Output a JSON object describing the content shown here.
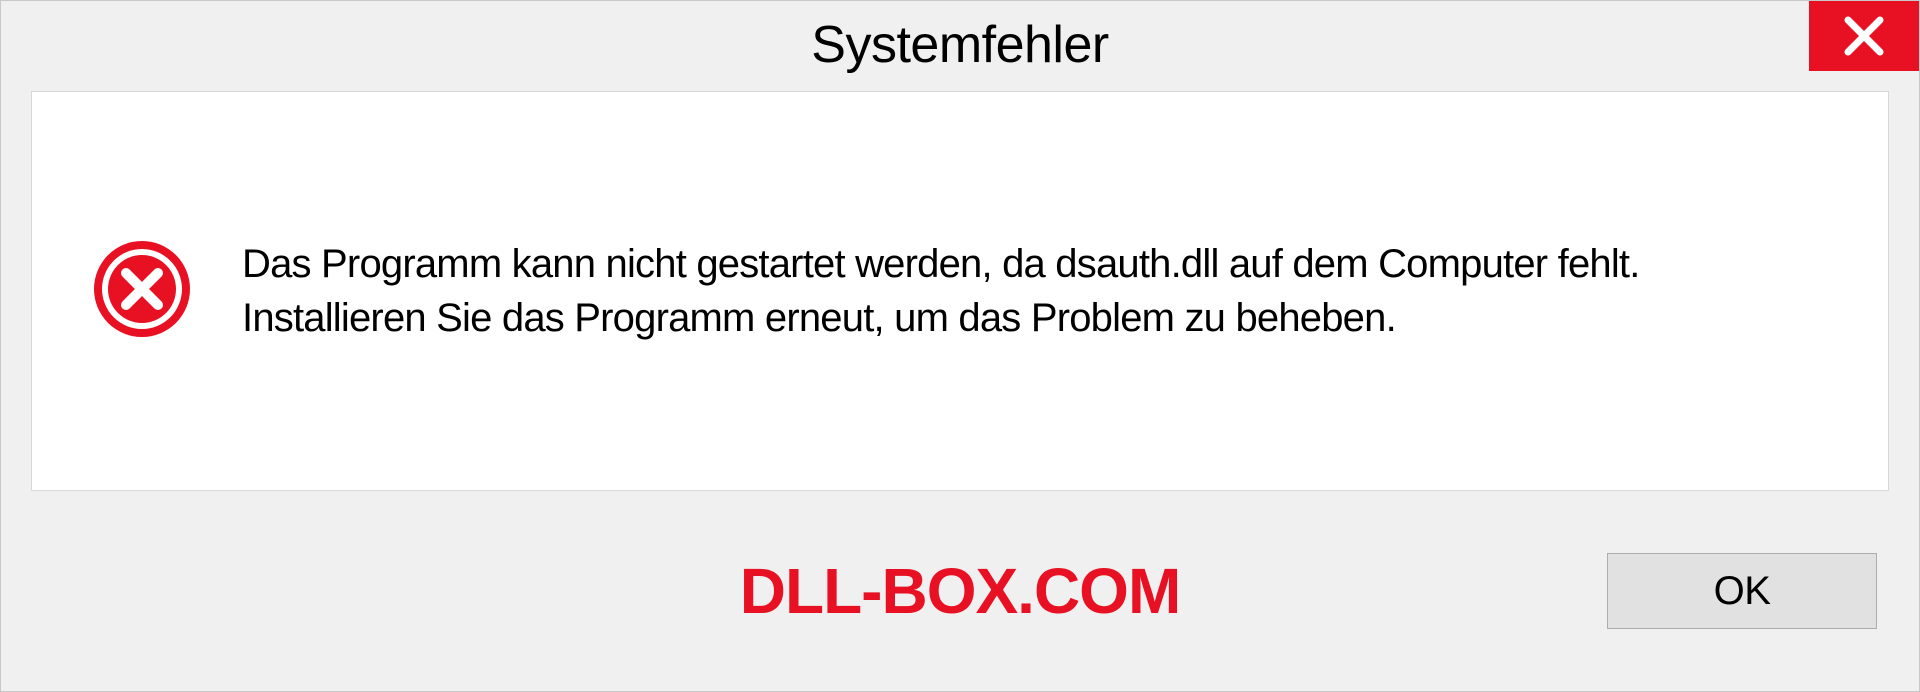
{
  "dialog": {
    "title": "Systemfehler",
    "message": "Das Programm kann nicht gestartet werden, da dsauth.dll auf dem Computer fehlt. Installieren Sie das Programm erneut, um das Problem zu beheben.",
    "ok_label": "OK"
  },
  "watermark": "DLL-BOX.COM"
}
